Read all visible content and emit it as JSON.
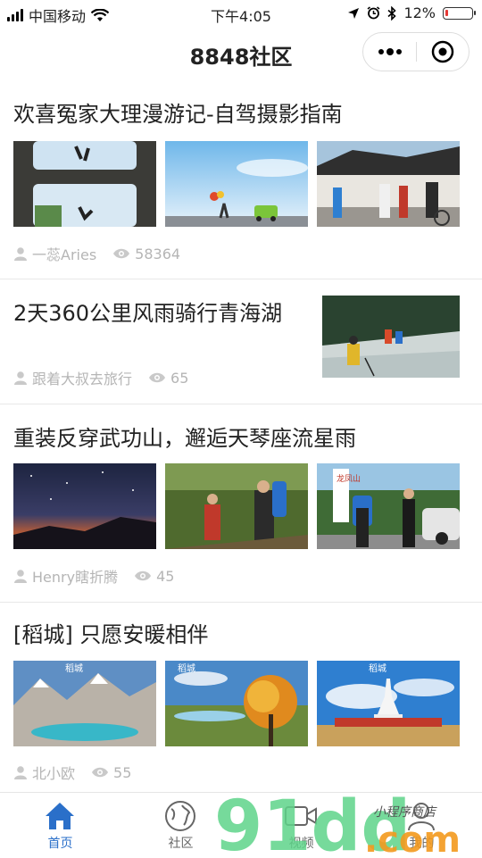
{
  "status_bar": {
    "carrier": "中国移动",
    "time": "下午4:05",
    "battery": "12%",
    "battery_level": 0.12
  },
  "nav": {
    "title": "8848社区"
  },
  "articles": [
    {
      "title": "欢喜冤家大理漫游记-自驾摄影指南",
      "author": "一蕊Aries",
      "views": "58364"
    },
    {
      "title": "2天360公里风雨骑行青海湖",
      "author": "跟着大叔去旅行",
      "views": "65"
    },
    {
      "title": "重装反穿武功山，邂逅天琴座流星雨",
      "author": "Henry瞎折腾",
      "views": "45"
    },
    {
      "title": "[稻城] 只愿安暖相伴",
      "author": "北小欧",
      "views": "55"
    }
  ],
  "photo_text": {
    "chengdao": "稻城",
    "mountain": "龙凤山"
  },
  "tabs": [
    {
      "label": "首页",
      "icon": "home-icon",
      "active": true
    },
    {
      "label": "社区",
      "icon": "globe-icon",
      "active": false
    },
    {
      "label": "视频",
      "icon": "video-icon",
      "active": false
    },
    {
      "label": "我的",
      "icon": "person-icon",
      "active": false
    }
  ],
  "watermark": {
    "big": "91dd.com",
    "small": "小程序商店"
  },
  "colors": {
    "accent": "#2a6fc9",
    "meta": "#b5b5b5",
    "battery_low": "#e53935"
  }
}
